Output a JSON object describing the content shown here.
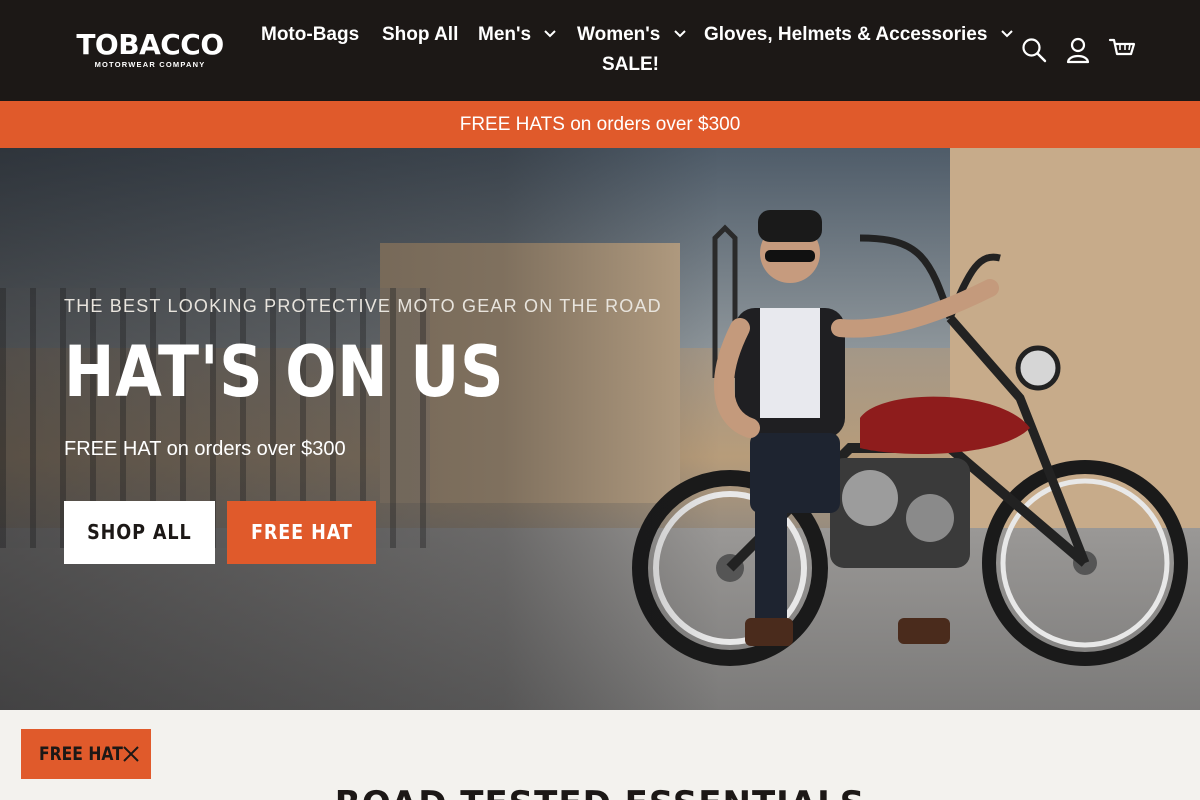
{
  "brand": {
    "logo_main": "TOBACCO",
    "logo_sub": "MOTORWEAR COMPANY"
  },
  "nav": {
    "items": [
      {
        "label": "Moto-Bags",
        "has_dropdown": false
      },
      {
        "label": "Shop All",
        "has_dropdown": false
      },
      {
        "label": "Men's",
        "has_dropdown": true
      },
      {
        "label": "Women's",
        "has_dropdown": true
      },
      {
        "label": "Gloves, Helmets & Accessories",
        "has_dropdown": true
      },
      {
        "label": "SALE!",
        "has_dropdown": false
      }
    ],
    "icons": [
      "search-icon",
      "account-icon",
      "cart-icon"
    ]
  },
  "announcement": {
    "text": "FREE HATS on orders over $300"
  },
  "hero": {
    "eyebrow": "THE BEST LOOKING PROTECTIVE MOTO GEAR ON THE ROAD",
    "headline": "HAT'S ON US",
    "subhead": "FREE HAT on orders over $300",
    "buttons": {
      "shop_all": "SHOP ALL",
      "free_hat": "FREE HAT"
    }
  },
  "floating_tag": {
    "label": "FREE HAT",
    "close_icon": "close-icon"
  },
  "section": {
    "title": "ROAD TESTED ESSENTIALS"
  },
  "colors": {
    "header_bg": "#1c1816",
    "accent": "#e05a2b",
    "page_bg": "#f3f2ee",
    "text_light": "#ffffff"
  }
}
